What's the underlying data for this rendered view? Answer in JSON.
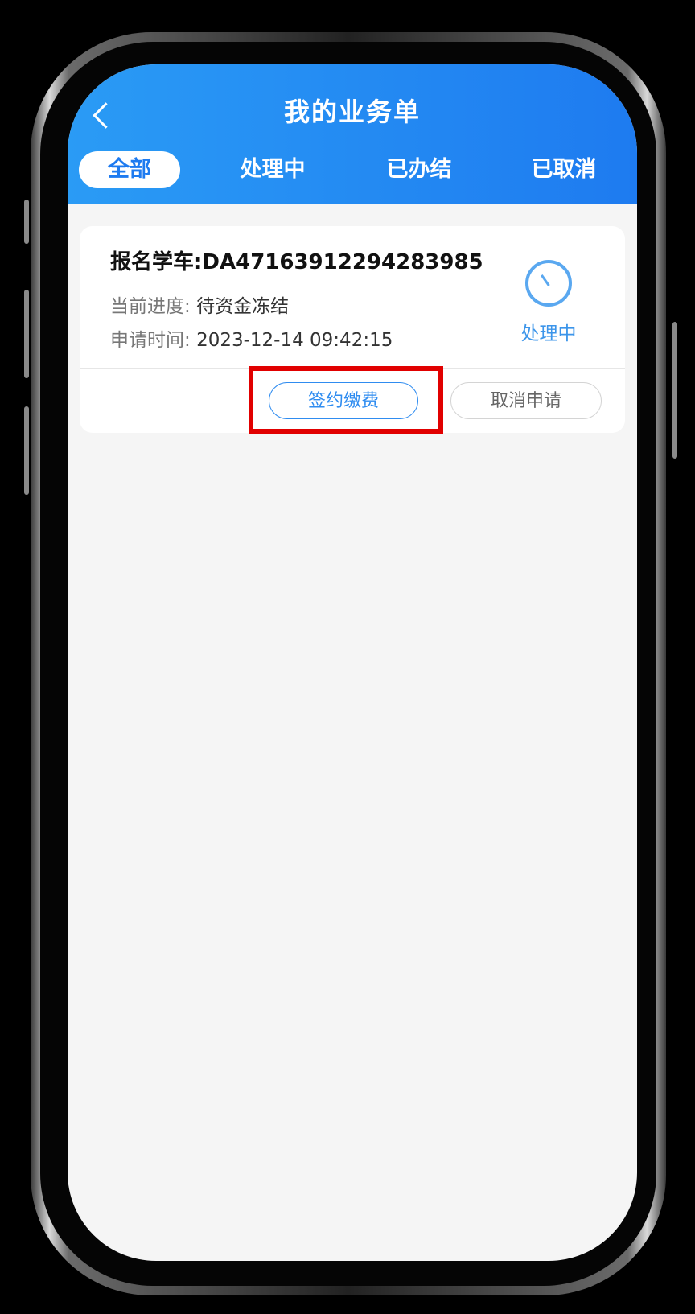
{
  "header": {
    "title": "我的业务单"
  },
  "tabs": [
    {
      "label": "全部",
      "active": true
    },
    {
      "label": "处理中",
      "active": false
    },
    {
      "label": "已办结",
      "active": false
    },
    {
      "label": "已取消",
      "active": false
    }
  ],
  "order": {
    "title": "报名学车:DA47163912294283985",
    "progress_label": "当前进度:",
    "progress_value": "待资金冻结",
    "time_label": "申请时间:",
    "time_value": "2023-12-14 09:42:15",
    "status": "处理中",
    "status_icon": "clock-icon",
    "actions": {
      "pay_label": "签约缴费",
      "cancel_label": "取消申请"
    }
  },
  "colors": {
    "header_start": "#2a9bf5",
    "header_end": "#1e7bf0",
    "accent": "#2f8cf0",
    "highlight": "#e10000"
  }
}
